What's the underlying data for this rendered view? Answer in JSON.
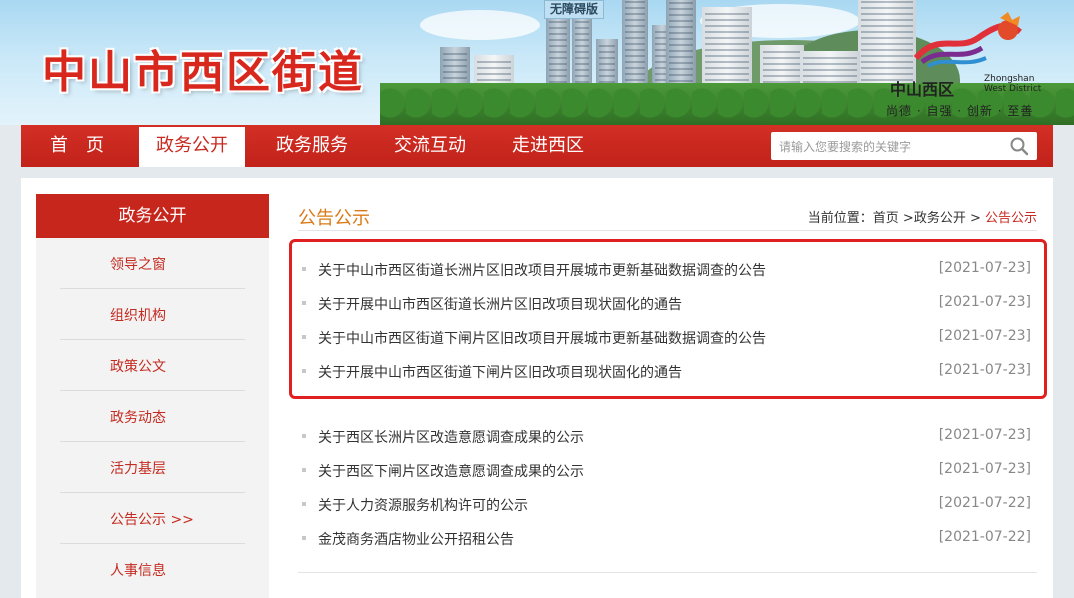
{
  "header": {
    "site_title": "中山市西区街道",
    "accessibility_label": "无障碍版",
    "logo": {
      "name_cn": "中山西区",
      "name_en_line1": "Zhongshan",
      "name_en_line2": "West District",
      "slogan": "尚德 · 自强 · 创新 · 至善"
    }
  },
  "nav": {
    "items": [
      {
        "label": "首　页",
        "active": false
      },
      {
        "label": "政务公开",
        "active": true
      },
      {
        "label": "政务服务",
        "active": false
      },
      {
        "label": "交流互动",
        "active": false
      },
      {
        "label": "走进西区",
        "active": false
      }
    ],
    "search_placeholder": "请输入您要搜索的关键字"
  },
  "sidebar": {
    "title": "政务公开",
    "items": [
      {
        "label": "领导之窗"
      },
      {
        "label": "组织机构"
      },
      {
        "label": "政策公文"
      },
      {
        "label": "政务动态"
      },
      {
        "label": "活力基层"
      },
      {
        "label": "公告公示 >>"
      },
      {
        "label": "人事信息"
      }
    ]
  },
  "main": {
    "title": "公告公示",
    "breadcrumb": {
      "prefix": "当前位置：",
      "home": "首页",
      "sep1": " >",
      "section": "政务公开",
      "sep2": " >",
      "current": " 公告公示"
    },
    "notices": [
      {
        "title": "关于中山市西区街道长洲片区旧改项目开展城市更新基础数据调查的公告",
        "date": "[2021-07-23]"
      },
      {
        "title": "关于开展中山市西区街道长洲片区旧改项目现状固化的通告",
        "date": "[2021-07-23]"
      },
      {
        "title": "关于中山市西区街道下闸片区旧改项目开展城市更新基础数据调查的公告",
        "date": "[2021-07-23]"
      },
      {
        "title": "关于开展中山市西区街道下闸片区旧改项目现状固化的通告",
        "date": "[2021-07-23]"
      },
      {
        "title": "关于西区长洲片区改造意愿调查成果的公示",
        "date": "[2021-07-23]"
      },
      {
        "title": "关于西区下闸片区改造意愿调查成果的公示",
        "date": "[2021-07-23]"
      },
      {
        "title": "关于人力资源服务机构许可的公示",
        "date": "[2021-07-22]"
      },
      {
        "title": "金茂商务酒店物业公开招租公告",
        "date": "[2021-07-22]"
      }
    ]
  },
  "colors": {
    "brand_red": "#c7261d",
    "title_orange": "#d97a16",
    "highlight_red": "#e02020"
  }
}
